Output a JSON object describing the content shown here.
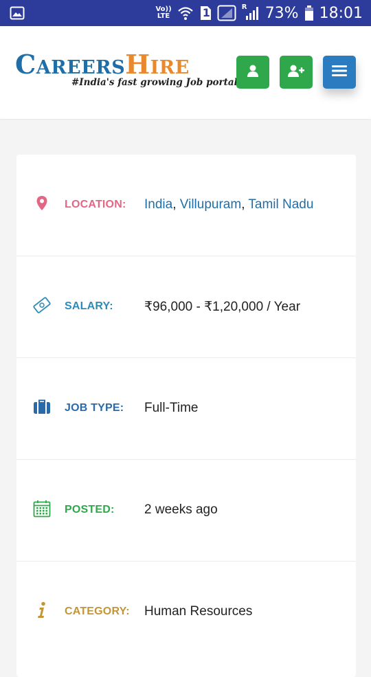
{
  "status_bar": {
    "lte_top": "Vo))",
    "lte_bottom": "LTE",
    "sim": "1",
    "roaming": "R",
    "battery": "73%",
    "time": "18:01"
  },
  "header": {
    "logo_part1": "Careers",
    "logo_part2": "Hire",
    "tagline": "#India's fast growing Job portal"
  },
  "colors": {
    "status_bar": "#2d3b9a",
    "green": "#2ea84a",
    "blue": "#2a7bbf",
    "logo_blue": "#1f6ea8",
    "logo_orange": "#e8892e"
  },
  "job": {
    "location": {
      "label": "LOCATION:",
      "country": "India",
      "city": "Villupuram",
      "state": "Tamil Nadu",
      "sep": ", "
    },
    "salary": {
      "label": "SALARY:",
      "value": "₹96,000 - ₹1,20,000 / Year"
    },
    "job_type": {
      "label": "JOB TYPE:",
      "value": "Full-Time"
    },
    "posted": {
      "label": "POSTED:",
      "value": "2 weeks ago"
    },
    "category": {
      "label": "CATEGORY:",
      "value": "Human Resources"
    }
  }
}
